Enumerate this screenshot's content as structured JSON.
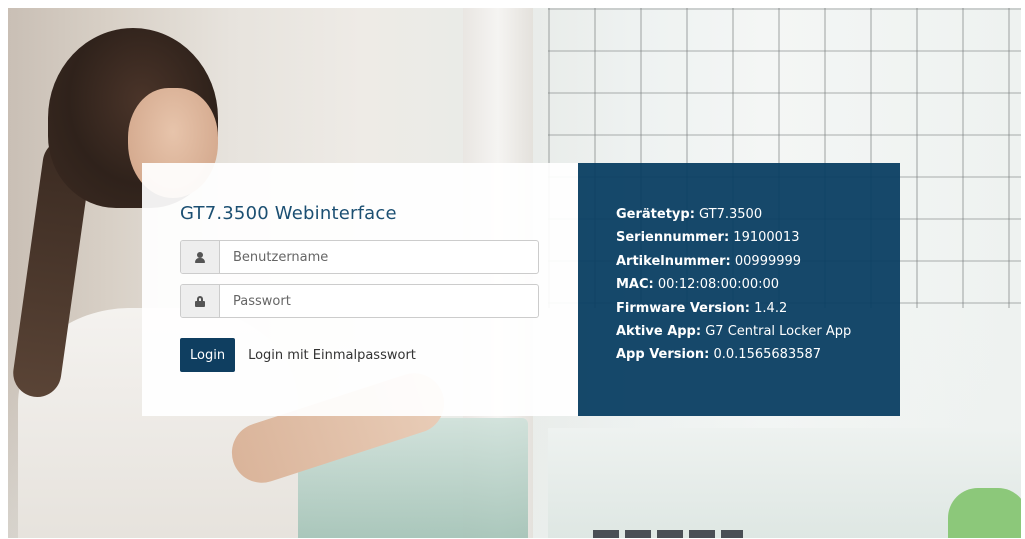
{
  "login": {
    "title": "GT7.3500 Webinterface",
    "username_placeholder": "Benutzername",
    "password_placeholder": "Passwort",
    "login_button": "Login",
    "otp_link": "Login mit Einmalpasswort"
  },
  "device_info": {
    "items": [
      {
        "label": "Gerätetyp:",
        "value": "GT7.3500"
      },
      {
        "label": "Seriennummer:",
        "value": "19100013"
      },
      {
        "label": "Artikelnummer:",
        "value": "00999999"
      },
      {
        "label": "MAC:",
        "value": "00:12:08:00:00:00"
      },
      {
        "label": "Firmware Version:",
        "value": "1.4.2"
      },
      {
        "label": "Aktive App:",
        "value": "G7 Central Locker App"
      },
      {
        "label": "App Version:",
        "value": "0.0.1565683587"
      }
    ]
  },
  "colors": {
    "primary": "#0f3e60",
    "info_panel_bg": "#0a3e62",
    "title": "#1b4f72"
  },
  "icons": {
    "username": "user-icon",
    "password": "lock-icon"
  }
}
